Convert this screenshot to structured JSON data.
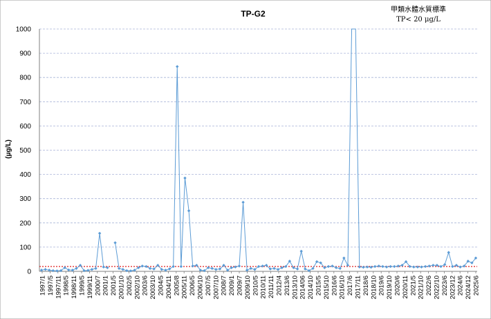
{
  "chart_data": {
    "type": "line",
    "title": "TP-G2",
    "ylabel": "(μg/L)",
    "xlabel": "",
    "standard_note": [
      "甲類水體水質標準",
      "TP< 20 μg/L"
    ],
    "ylim": [
      0,
      1000
    ],
    "yticks": [
      0,
      100,
      200,
      300,
      400,
      500,
      600,
      700,
      800,
      900,
      1000
    ],
    "grid": true,
    "legend": "none",
    "x_tick_labels": [
      "1997/1",
      "1997/5",
      "1997/11",
      "1998/5",
      "1998/11",
      "1999/5",
      "1999/11",
      "2000/7",
      "2001/1",
      "2001/5",
      "2001/10",
      "2002/5",
      "2002/10",
      "2003/6",
      "2003/10",
      "2004/5",
      "2004/11",
      "2005/8",
      "2005/11",
      "2006/5",
      "2006/10",
      "2007/5",
      "2007/10",
      "2008/7",
      "2009/1",
      "2009/7",
      "2009/10",
      "2010/5",
      "2010/11",
      "2011/11",
      "2012/4",
      "2013/6",
      "2013/10",
      "2014/06",
      "2014/10",
      "2015/5",
      "2015/10",
      "2016/6",
      "2016/10",
      "2017/6",
      "2017/11",
      "2018/6",
      "2018/10",
      "2019/6",
      "2019/10",
      "2020/6",
      "2020/11",
      "2021/5",
      "2021/10",
      "2022/6",
      "2022/10",
      "2023/6",
      "2023/12",
      "2024/6",
      "2024/12",
      "2025/6"
    ],
    "series": [
      {
        "values": [
          5,
          8,
          5,
          3,
          2,
          3,
          15,
          6,
          5,
          12,
          25,
          3,
          4,
          8,
          12,
          157,
          18,
          15,
          null,
          118,
          12,
          8,
          3,
          2,
          5,
          15,
          22,
          20,
          12,
          10,
          25,
          8,
          5,
          10,
          20,
          845,
          20,
          385,
          250,
          22,
          25,
          5,
          3,
          15,
          12,
          8,
          10,
          25,
          5,
          15,
          18,
          22,
          285,
          5,
          12,
          8,
          20,
          22,
          25,
          10,
          12,
          8,
          15,
          20,
          42,
          15,
          10,
          83,
          10,
          3,
          12,
          40,
          35,
          15,
          20,
          22,
          15,
          12,
          55,
          25,
          1000,
          1000,
          18,
          17,
          18,
          17,
          20,
          22,
          20,
          18,
          20,
          20,
          22,
          25,
          40,
          20,
          18,
          18,
          18,
          20,
          22,
          25,
          25,
          20,
          28,
          78,
          20,
          25,
          18,
          22,
          42,
          35,
          55
        ],
        "color": "#5b9bd5"
      }
    ],
    "standard_line": {
      "value": 20,
      "color": "#e03030"
    }
  }
}
